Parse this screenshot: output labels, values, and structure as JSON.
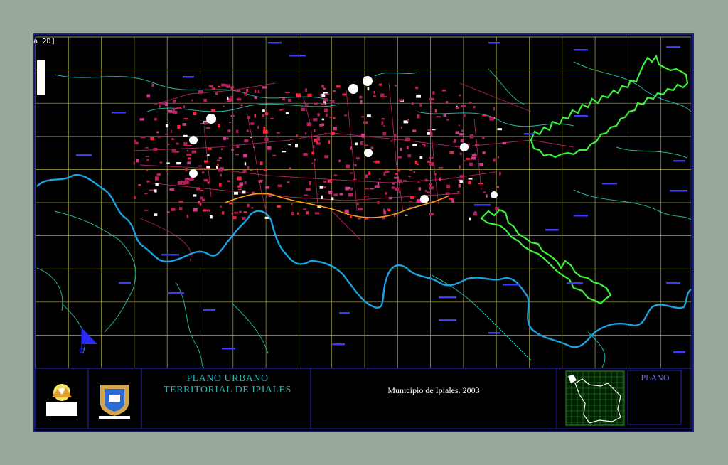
{
  "viewport": {
    "label": "a 2D]"
  },
  "title_block": {
    "title_line1": "PLANO URBANO",
    "title_line2": "TERRITORIAL DE IPIALES",
    "subtitle": "Municipio de Ipiales. 2003",
    "plano_label": "PLANO"
  },
  "colors": {
    "background": "#9aa89a",
    "canvas": "#000000",
    "grid": "#c8c84a",
    "frame": "#2020a0",
    "river": "#1aa3e0",
    "boundary": "#3cf03c",
    "streets": "#b0205a",
    "highway": "#ff9a1a",
    "contour": "#2bc4b0",
    "labels": "#3a3aff",
    "title": "#2fb3b3"
  },
  "icons": [
    "north-arrow-icon",
    "municipal-logo-icon",
    "coat-of-arms-icon",
    "location-minimap-icon"
  ]
}
